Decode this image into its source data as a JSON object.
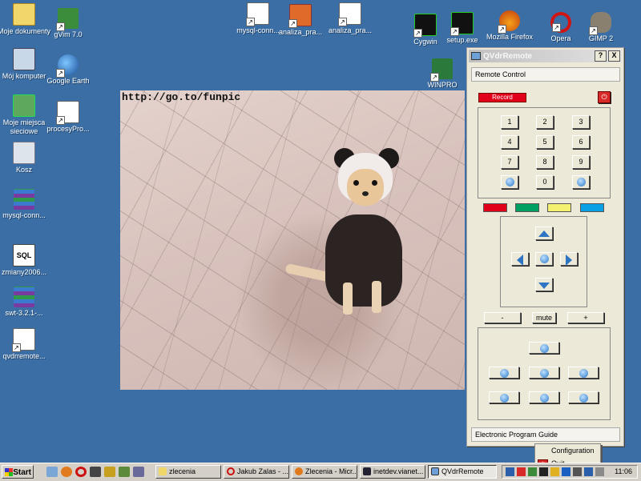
{
  "desktop_icons": [
    {
      "label": "Moje dokumenty",
      "icon": "my-documents-icon"
    },
    {
      "label": "gVim 7.0",
      "icon": "gvim-icon"
    },
    {
      "label": "Mój komputer",
      "icon": "my-computer-icon"
    },
    {
      "label": "Google Earth",
      "icon": "google-earth-icon"
    },
    {
      "label": "Moje miejsca sieciowe",
      "icon": "network-places-icon"
    },
    {
      "label": "procesyPro...",
      "icon": "document-icon"
    },
    {
      "label": "Kosz",
      "icon": "recycle-bin-icon"
    },
    {
      "label": "mysql-conn...",
      "icon": "archive-icon"
    },
    {
      "label": "zmiany2006...",
      "icon": "sql-file-icon"
    },
    {
      "label": "swt-3.2.1-...",
      "icon": "archive-icon"
    },
    {
      "label": "qvdrremote...",
      "icon": "file-icon"
    },
    {
      "label": "mysql-conn...",
      "icon": "document-icon"
    },
    {
      "label": "analiza_pra...",
      "icon": "powerpoint-icon"
    },
    {
      "label": "analiza_pra...",
      "icon": "document-icon"
    },
    {
      "label": "Cygwin",
      "icon": "cygwin-icon"
    },
    {
      "label": "setup.exe",
      "icon": "cygwin-setup-icon"
    },
    {
      "label": "Mozilla Firefox",
      "icon": "firefox-icon"
    },
    {
      "label": "Opera",
      "icon": "opera-icon"
    },
    {
      "label": "GIMP 2",
      "icon": "gimp-icon"
    },
    {
      "label": "WINPRO",
      "icon": "winpro-icon"
    }
  ],
  "photo": {
    "caption": "http://go.to/funpic"
  },
  "window": {
    "title": "QVdrRemote",
    "help_label": "?",
    "close_label": "X",
    "remote_section": "Remote Control",
    "record_label": "Record",
    "digits": [
      "1",
      "2",
      "3",
      "4",
      "5",
      "6",
      "7",
      "8",
      "9",
      "0"
    ],
    "color_buttons": [
      "#e0001a",
      "#00a060",
      "#f4f070",
      "#0aa0e6"
    ],
    "vol_down": "-",
    "mute": "mute",
    "vol_up": "+",
    "epg_section": "Electronic Program Guide"
  },
  "taskbar": {
    "start_label": "Start",
    "tasks": [
      {
        "label": "zlecenia",
        "icon": "folder-icon"
      },
      {
        "label": "Jakub Zalas - ...",
        "icon": "opera-icon"
      },
      {
        "label": "Zlecenia - Micr...",
        "icon": "firefox-icon"
      },
      {
        "label": "inetdev.vianet...",
        "icon": "terminal-icon"
      },
      {
        "label": "QVdrRemote",
        "icon": "qvdrremote-icon"
      }
    ],
    "clock": "11:06"
  },
  "context_menu": {
    "items": [
      {
        "label": "Configuration",
        "icon": ""
      },
      {
        "label": "Quit",
        "icon": "quit-icon"
      }
    ]
  }
}
